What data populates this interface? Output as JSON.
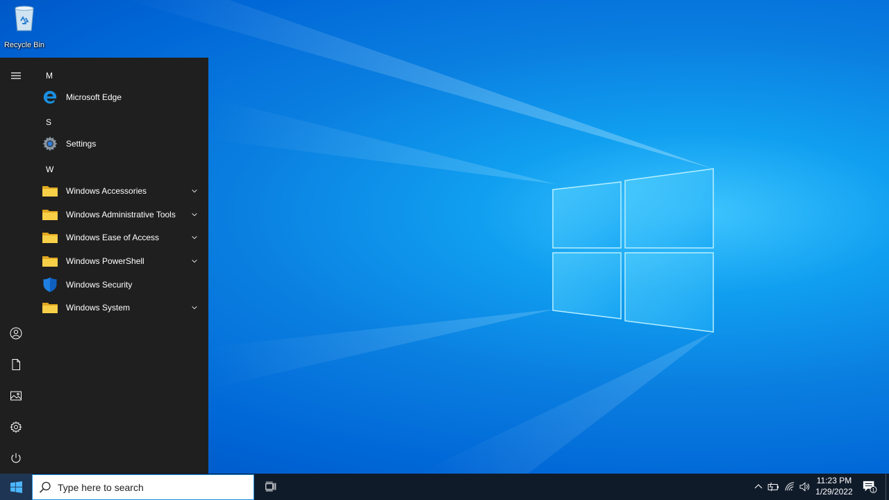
{
  "desktop": {
    "icons": [
      {
        "label": "Recycle Bin",
        "icon": "recycle-bin-icon"
      }
    ]
  },
  "start_menu": {
    "rail": [
      {
        "name": "expand",
        "icon": "hamburger-icon"
      },
      {
        "name": "account",
        "icon": "user-icon"
      },
      {
        "name": "documents",
        "icon": "document-icon"
      },
      {
        "name": "pictures",
        "icon": "pictures-icon"
      },
      {
        "name": "settings",
        "icon": "gear-icon"
      },
      {
        "name": "power",
        "icon": "power-icon"
      }
    ],
    "letters": {
      "m": "M",
      "s": "S",
      "w": "W"
    },
    "apps": [
      {
        "label": "Microsoft Edge",
        "icon": "edge-icon",
        "expandable": false
      },
      {
        "label": "Settings",
        "icon": "settings-gear-icon",
        "expandable": false
      },
      {
        "label": "Windows Accessories",
        "icon": "folder-icon",
        "expandable": true
      },
      {
        "label": "Windows Administrative Tools",
        "icon": "folder-icon",
        "expandable": true
      },
      {
        "label": "Windows Ease of Access",
        "icon": "folder-icon",
        "expandable": true
      },
      {
        "label": "Windows PowerShell",
        "icon": "folder-icon",
        "expandable": true
      },
      {
        "label": "Windows Security",
        "icon": "shield-icon",
        "expandable": false
      },
      {
        "label": "Windows System",
        "icon": "folder-icon",
        "expandable": true
      }
    ]
  },
  "taskbar": {
    "search_placeholder": "Type here to search",
    "clock": {
      "time": "11:23 PM",
      "date": "1/29/2022"
    },
    "notification_count": "1"
  },
  "colors": {
    "menu_bg": "#1f1f1f",
    "taskbar_bg": "#101b2a",
    "folder": "#f5c542",
    "accent": "#0078d7"
  }
}
